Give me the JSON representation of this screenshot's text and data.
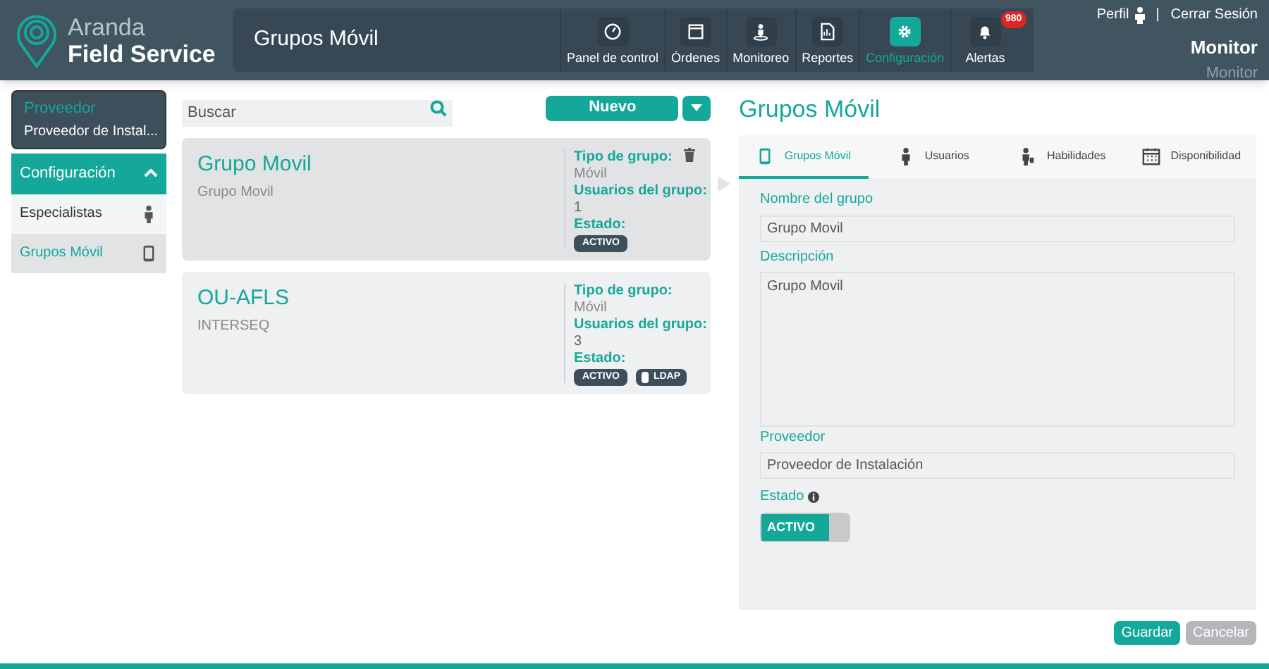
{
  "logo": {
    "line1": "Aranda",
    "line2": "Field Service"
  },
  "page_title": "Grupos Móvil",
  "nav": [
    {
      "label": "Panel de control",
      "kind": "gauge",
      "selected": false
    },
    {
      "label": "Órdenes",
      "kind": "window",
      "selected": false
    },
    {
      "label": "Monitoreo",
      "kind": "monitor",
      "selected": false
    },
    {
      "label": "Reportes",
      "kind": "report",
      "selected": false
    },
    {
      "label": "Configuración",
      "kind": "settings",
      "selected": true
    },
    {
      "label": "Alertas",
      "kind": "alerts",
      "selected": false,
      "badge": "980"
    }
  ],
  "user": {
    "profile": "Perfil",
    "separator": "|",
    "logout": "Cerrar Sesión",
    "name": "Monitor",
    "role": "Monitor"
  },
  "provider_select": {
    "label": "Proveedor",
    "value": "Proveedor de Instal..."
  },
  "sidebar": {
    "section": "Configuración",
    "expanded": true,
    "items": [
      {
        "label": "Especialistas",
        "kind": "person",
        "selected": false
      },
      {
        "label": "Grupos Móvil",
        "kind": "phone",
        "selected": true
      }
    ]
  },
  "search": {
    "placeholder": "Buscar"
  },
  "new_button": "Nuevo",
  "groups": [
    {
      "name": "Grupo Movil",
      "description": "Grupo Movil",
      "type_label": "Tipo de grupo:",
      "type": "Móvil",
      "users_label": "Usuarios del grupo:",
      "users": "1",
      "status_label": "Estado:",
      "tags": [
        {
          "kind": "status",
          "text": "ACTIVO"
        }
      ],
      "selected": true
    },
    {
      "name": "OU-AFLS",
      "description": "INTERSEQ",
      "type_label": "Tipo de grupo:",
      "type": "Móvil",
      "users_label": "Usuarios del grupo:",
      "users": "3",
      "status_label": "Estado:",
      "tags": [
        {
          "kind": "status",
          "text": "ACTIVO"
        },
        {
          "kind": "ldap",
          "text": "LDAP"
        }
      ],
      "selected": false
    }
  ],
  "detail": {
    "title": "Grupos Móvil",
    "tabs": [
      {
        "label": "Grupos Móvil",
        "kind": "phone",
        "selected": true
      },
      {
        "label": "Usuarios",
        "kind": "person",
        "selected": false
      },
      {
        "label": "Habilidades",
        "kind": "worker",
        "selected": false
      },
      {
        "label": "Disponibilidad",
        "kind": "calendar",
        "selected": false
      }
    ],
    "name_label": "Nombre del grupo",
    "name_value": "Grupo Movil",
    "description_label": "Descripción",
    "description_value": "Grupo Movil",
    "provider_label": "Proveedor",
    "provider_value": "Proveedor de Instalación",
    "status_label": "Estado",
    "status_toggle": {
      "text": "ACTIVO",
      "on": true
    }
  },
  "buttons": {
    "save": "Guardar",
    "cancel": "Cancelar"
  }
}
